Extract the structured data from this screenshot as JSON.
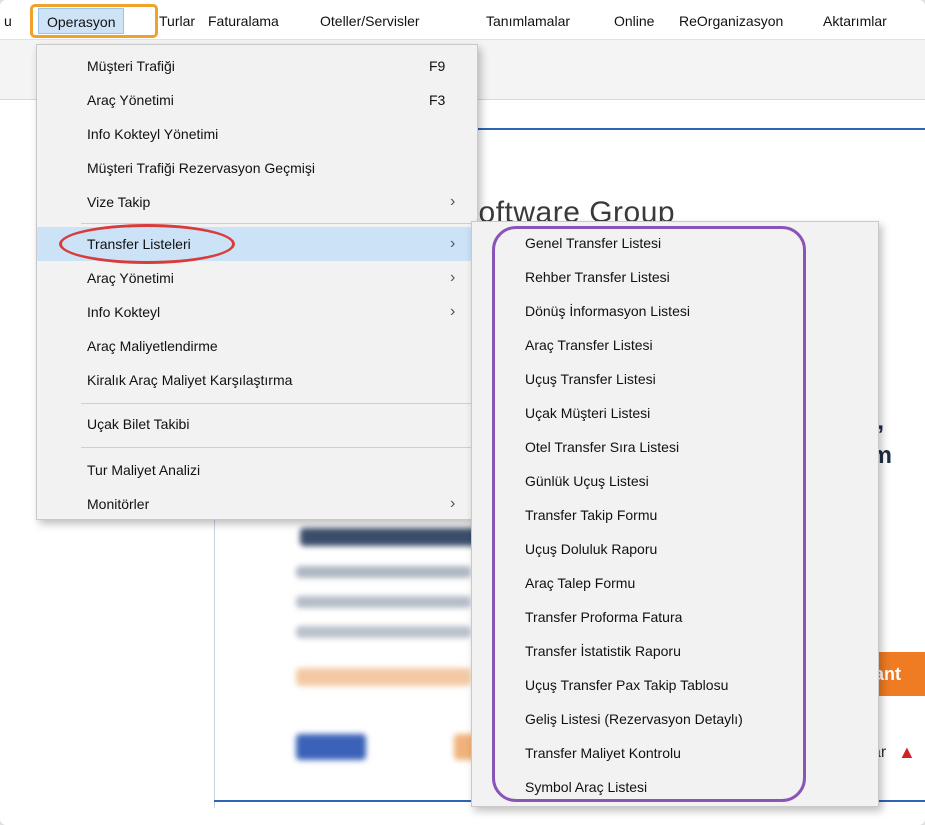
{
  "menubar": {
    "items": [
      {
        "label": "u"
      },
      {
        "label": "Operasyon"
      },
      {
        "label": "Turlar"
      },
      {
        "label": "Faturalama"
      },
      {
        "label": "Oteller/Servisler"
      },
      {
        "label": "Tanımlamalar"
      },
      {
        "label": "Online"
      },
      {
        "label": "ReOrganizasyon"
      },
      {
        "label": "Aktarımlar"
      }
    ]
  },
  "background": {
    "heading": "Software Group",
    "side_text_1": "ni,",
    "side_text_2": "um",
    "orange_button": "ant",
    "partial_text": "ar"
  },
  "dropdown": {
    "items": [
      {
        "label": "Müşteri Trafiği",
        "shortcut": "F9"
      },
      {
        "label": "Araç Yönetimi",
        "shortcut": "F3"
      },
      {
        "label": "Info Kokteyl Yönetimi"
      },
      {
        "label": "Müşteri Trafiği Rezervasyon Geçmişi"
      },
      {
        "label": "Vize Takip",
        "submenu": "›"
      },
      {
        "label": "Transfer Listeleri",
        "submenu": "›"
      },
      {
        "label": "Araç Yönetimi",
        "submenu": "›"
      },
      {
        "label": "Info Kokteyl",
        "submenu": "›"
      },
      {
        "label": "Araç Maliyetlendirme"
      },
      {
        "label": "Kiralık Araç Maliyet Karşılaştırma"
      },
      {
        "label": "Uçak Bilet Takibi"
      },
      {
        "label": "Tur Maliyet Analizi"
      },
      {
        "label": "Monitörler",
        "submenu": "›"
      }
    ]
  },
  "submenu": {
    "items": [
      {
        "label": "Genel Transfer Listesi"
      },
      {
        "label": "Rehber Transfer Listesi"
      },
      {
        "label": "Dönüş İnformasyon Listesi"
      },
      {
        "label": "Araç Transfer Listesi"
      },
      {
        "label": "Uçuş Transfer Listesi"
      },
      {
        "label": "Uçak Müşteri Listesi"
      },
      {
        "label": "Otel Transfer Sıra Listesi"
      },
      {
        "label": "Günlük Uçuş Listesi"
      },
      {
        "label": "Transfer Takip Formu"
      },
      {
        "label": "Uçuş Doluluk Raporu"
      },
      {
        "label": "Araç Talep Formu"
      },
      {
        "label": "Transfer Proforma Fatura"
      },
      {
        "label": "Transfer İstatistik Raporu"
      },
      {
        "label": "Uçuş Transfer Pax Takip Tablosu"
      },
      {
        "label": "Geliş Listesi (Rezervasyon Detaylı)"
      },
      {
        "label": "Transfer Maliyet Kontrolu"
      },
      {
        "label": "Symbol Araç Listesi"
      }
    ]
  },
  "colors": {
    "menu_active": "#cfe3f7",
    "highlight_orange": "#f0a12a",
    "highlight_red": "#d93a3a",
    "highlight_purple": "#8a55b7",
    "brand_blue": "#2f63b4"
  }
}
